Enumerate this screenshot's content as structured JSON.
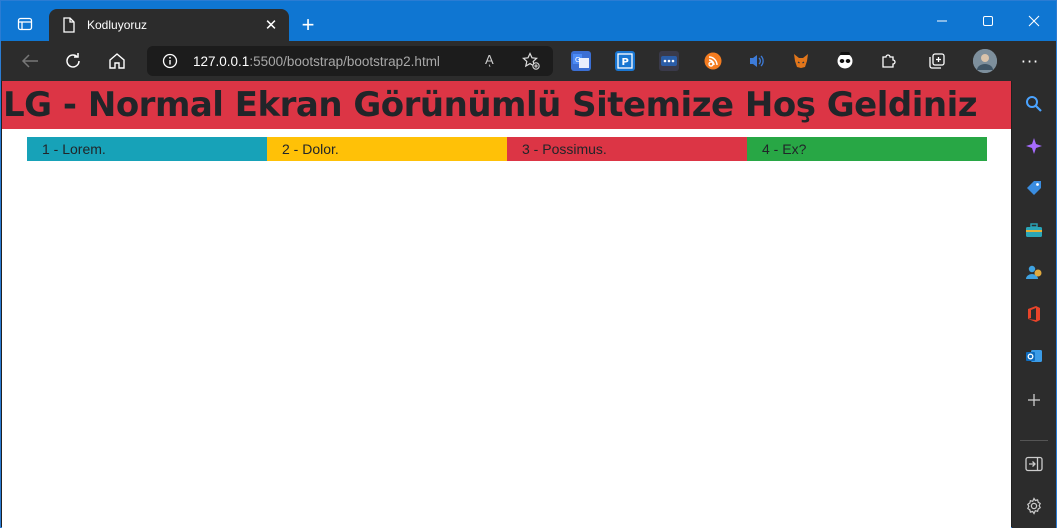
{
  "browser": {
    "tab_title": "Kodluyoruz",
    "url_host": "127.0.0.1",
    "url_path": ":5500/bootstrap/bootstrap2.html",
    "read_aloud_label": "Aͅ",
    "more_label": "···",
    "new_tab_label": "+",
    "close_tab_label": "✕"
  },
  "page": {
    "heading": "LG - Normal Ekran Görünümlü Sitemize Hoş Geldiniz",
    "columns": [
      {
        "label": "1 - Lorem.",
        "color": "#17a2b8"
      },
      {
        "label": "2 - Dolor.",
        "color": "#ffc107"
      },
      {
        "label": "3 - Possimus.",
        "color": "#dc3545"
      },
      {
        "label": "4 - Ex?",
        "color": "#28a745"
      }
    ]
  },
  "colors": {
    "titlebar": "#0f76d2",
    "toolbar": "#2c2c2c",
    "heading_bg": "#dc3545"
  },
  "icons": {
    "toolbar_extensions": [
      "translate-extension-icon",
      "p-extension-icon",
      "dots-extension-icon",
      "rss-extension-icon",
      "sound-extension-icon",
      "fox-extension-icon",
      "panda-extension-icon",
      "puzzle-icon",
      "collections-icon",
      "profile-avatar"
    ],
    "sidebar": [
      "search-icon",
      "sparkle-icon",
      "tag-icon",
      "toolbox-icon",
      "people-icon",
      "office-icon",
      "outlook-icon",
      "plus-icon",
      "sidebar-toggle-icon",
      "gear-icon"
    ]
  }
}
